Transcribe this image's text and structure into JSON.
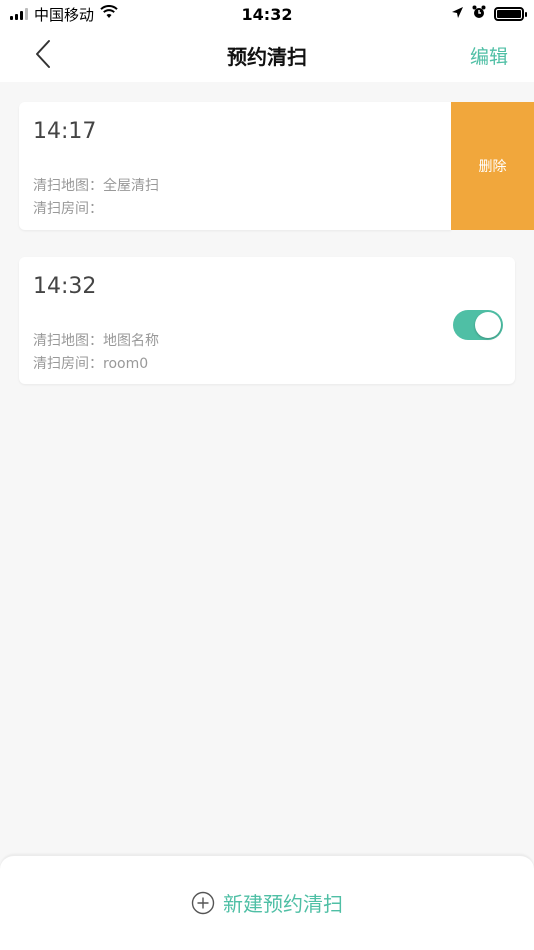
{
  "status_bar": {
    "carrier": "中国移动",
    "time": "14:32"
  },
  "nav": {
    "title": "预约清扫",
    "edit_label": "编辑"
  },
  "schedules": [
    {
      "time": "14:17",
      "map_line": "清扫地图：全屋清扫",
      "room_line": "清扫房间：",
      "swipe_action": "删除"
    },
    {
      "time": "14:32",
      "map_line": "清扫地图：地图名称",
      "room_line": "清扫房间：room0",
      "enabled": true
    }
  ],
  "bottom": {
    "new_label": "新建预约清扫"
  },
  "colors": {
    "accent": "#4fbfa5",
    "delete": "#f1a73c",
    "background": "#f7f7f7"
  },
  "icons": [
    "signal-icon",
    "wifi-icon",
    "location-arrow-icon",
    "alarm-icon",
    "battery-icon",
    "back-chevron-icon",
    "add-circle-icon"
  ]
}
